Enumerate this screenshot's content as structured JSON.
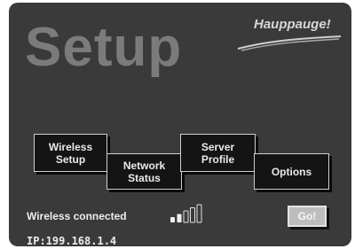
{
  "page": {
    "title": "Setup",
    "brand": "Hauppauge!"
  },
  "menu": {
    "wireless_setup": [
      "Wireless",
      "Setup"
    ],
    "network_status": [
      "Network",
      "Status"
    ],
    "server_profile": [
      "Server",
      "Profile"
    ],
    "options": "Options"
  },
  "status": {
    "connection": "Wireless connected",
    "signal_bars_filled": 2,
    "signal_bars_total": 5,
    "ip": "IP:199.168.1.4"
  },
  "actions": {
    "go_label": "Go!"
  },
  "colors": {
    "background": "#3a3a3a",
    "tile": "#141414",
    "title": "#7b7b7b",
    "go_button": "#bdbdbd"
  }
}
